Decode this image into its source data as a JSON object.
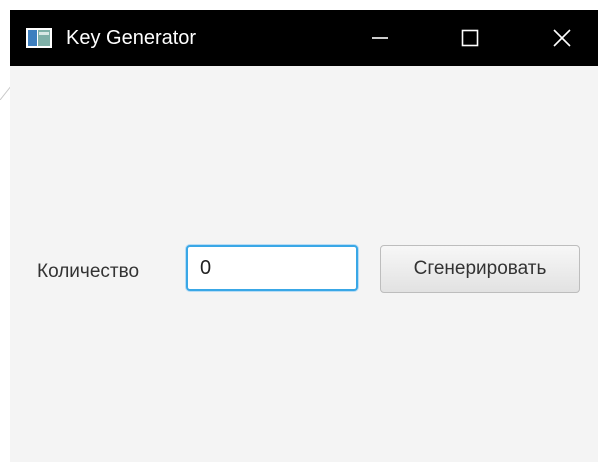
{
  "window": {
    "title": "Key Generator",
    "app_icon": "app-window-icon",
    "controls": {
      "minimize_icon": "minimize-icon",
      "maximize_icon": "maximize-icon",
      "close_icon": "close-icon"
    }
  },
  "form": {
    "quantity_label": "Количество",
    "quantity_value": "0",
    "generate_button_label": "Сгенерировать"
  },
  "colors": {
    "titlebar_background": "#000000",
    "content_background": "#f4f4f4",
    "input_focus_border": "#39a7e6"
  }
}
